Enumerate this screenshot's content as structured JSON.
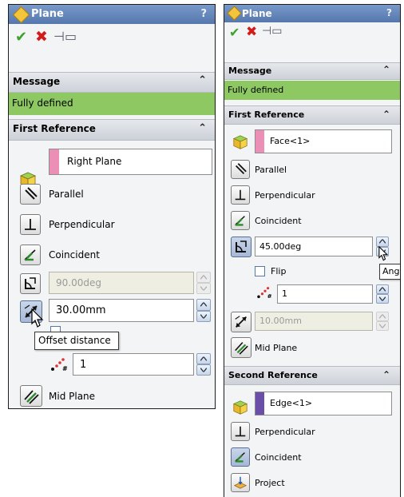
{
  "left_panel": {
    "title": "Plane",
    "help": "?",
    "message_header": "Message",
    "message_text": "Fully defined",
    "first_ref_header": "First Reference",
    "reference_value": "Right Plane",
    "reference_color": "#ec8fb6",
    "parallel": "Parallel",
    "perpendicular": "Perpendicular",
    "coincident": "Coincident",
    "angle_value": "90.00deg",
    "offset_value": "30.00mm",
    "tooltip": "Offset distance",
    "count_value": "1",
    "mid_plane": "Mid Plane"
  },
  "right_panel": {
    "title": "Plane",
    "help": "?",
    "message_header": "Message",
    "message_text": "Fully defined",
    "first_ref_header": "First Reference",
    "reference_value": "Face<1>",
    "reference_color": "#ec8fb6",
    "parallel": "Parallel",
    "perpendicular": "Perpendicular",
    "coincident": "Coincident",
    "angle_value": "45.00deg",
    "tooltip": "Angle",
    "flip": "Flip",
    "count_value": "1",
    "offset_value": "10.00mm",
    "mid_plane": "Mid Plane",
    "second_ref_header": "Second Reference",
    "second_reference_value": "Edge<1>",
    "second_reference_color": "#6a4fa8",
    "second_perpendicular": "Perpendicular",
    "second_coincident": "Coincident",
    "project": "Project"
  },
  "colors": {
    "title_bar": "#5f80b8",
    "message_bg": "#8dc862",
    "ok_check": "#3ea22a",
    "cancel_x": "#d21b1b"
  }
}
